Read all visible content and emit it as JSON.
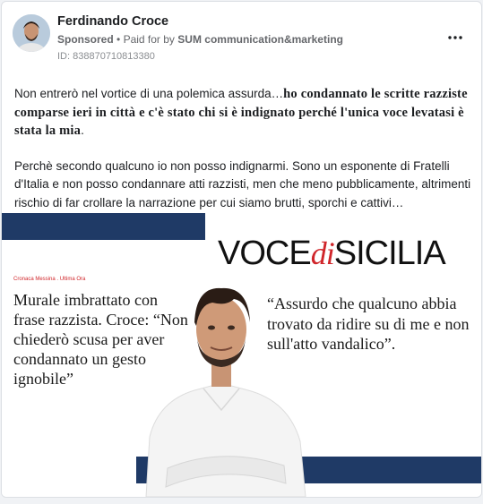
{
  "post": {
    "author": "Ferdinando Croce",
    "sponsored": "Sponsored",
    "separator": "•",
    "paid_for_by_prefix": "Paid for by",
    "paid_for_by_name": "SUM communication&marketing",
    "ad_id": "ID: 838870710813380",
    "more_icon": "more-options-icon",
    "text": {
      "p1_plain": "Non entrerò nel vortice di una polemica assurda…",
      "p1_bold": "ho condannato le scritte razziste comparse ieri in città e c'è stato chi si è indignato perché l'unica voce levatasi è stata la mia",
      "p1_end": ".",
      "p2": "Perchè secondo qualcuno io non posso indignarmi. Sono un esponente di Fratelli d'Italia e non posso condannare atti razzisti, men che meno pubblicamente, altrimenti rischio di far crollare la narrazione per cui siamo brutti, sporchi e cattivi…"
    }
  },
  "creative": {
    "brand_part1": "VOCE",
    "brand_di": "di",
    "brand_part2": "SICILIA",
    "kicker": "Cronaca Messina . Ultima Ora",
    "headline": "Murale imbrattato con frase razzista. Croce: “Non chiederò scusa per aver condannato un gesto ignobile”",
    "quote": "“Assurdo che qualcuno abbia trovato da ridire su di me e non sull'atto vandalico”.",
    "colors": {
      "navy": "#1f3a66",
      "red": "#d0262b"
    }
  }
}
